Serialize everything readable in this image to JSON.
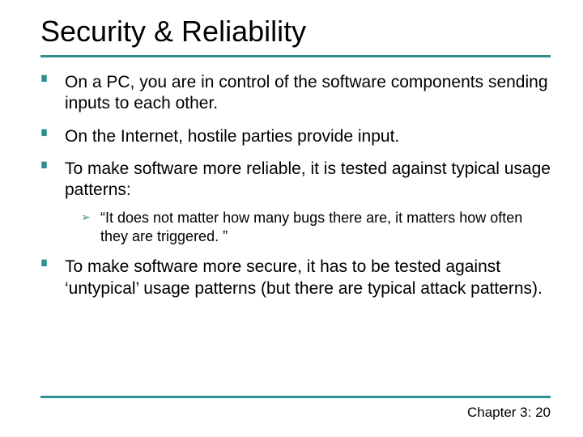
{
  "title": "Security & Reliability",
  "bullets": [
    {
      "text": "On a PC, you are in control of the software components sending inputs to each other."
    },
    {
      "text": "On the Internet, hostile parties provide input."
    },
    {
      "text": "To make software more reliable, it is tested against typical usage patterns:",
      "sub": [
        "“It does not matter how many bugs there are, it matters how often they are triggered. ”"
      ]
    },
    {
      "text": "To make software more secure, it has to be tested against ‘untypical’ usage patterns (but there are typical attack patterns)."
    }
  ],
  "footer": "Chapter 3: 20"
}
